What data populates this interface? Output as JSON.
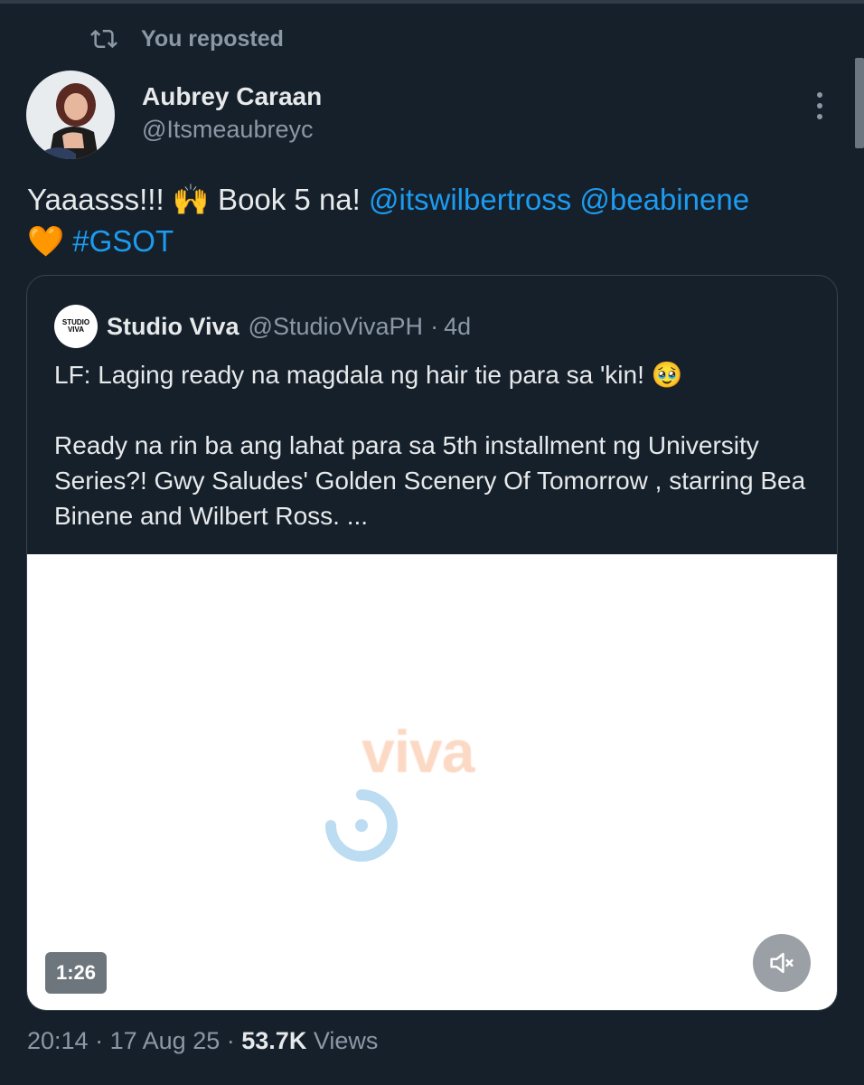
{
  "repost": {
    "label": "You reposted",
    "icon": "repost-icon"
  },
  "tweet": {
    "author_name": "Aubrey Caraan",
    "author_handle": "@Itsmeaubreyc",
    "text_prefix": "Yaaasss!!! 🙌 Book 5 na! ",
    "mention_1": "@itswilbertross",
    "mention_2": "@beabinene",
    "emoji": "🧡",
    "hashtag": "#GSOT",
    "time": "20:14",
    "date": "17 Aug 25",
    "views_count": "53.7K",
    "views_label": "Views",
    "separator": "·"
  },
  "quote": {
    "avatar_text_top": "STUDIO",
    "avatar_text_bottom": "VIVA",
    "name": "Studio Viva",
    "handle": "@StudioVivaPH",
    "time": "4d",
    "separator": "·",
    "text": "LF: Laging ready na magdala ng hair tie para sa 'kin! 🥹\n\nReady na rin ba ang lahat para sa 5th installment ng University Series?! Gwy Saludes' Golden Scenery Of Tomorrow , starring Bea Binene and Wilbert Ross. ..."
  },
  "media": {
    "logo_text": "viva",
    "duration": "1:26",
    "mute_icon": "speaker-muted-icon"
  },
  "colors": {
    "background": "#15202b",
    "link": "#1d9bf0",
    "secondary_text": "#8b98a5",
    "primary_text": "#e7e9ea"
  }
}
